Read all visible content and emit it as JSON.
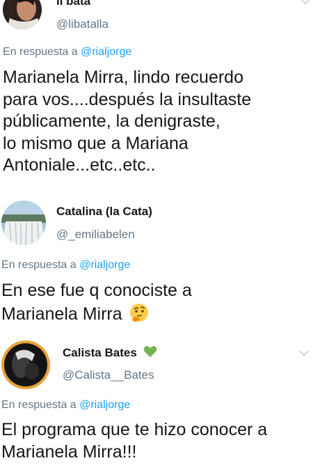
{
  "tweets": [
    {
      "name": "li bata",
      "handle": "@libatalla",
      "reply_prefix": "En respuesta a",
      "reply_to": "@rialjorge",
      "lines": [
        "Marianela Mirra, lindo recuerdo",
        "para vos....después la insultaste",
        "públicamente, la denigraste,",
        "lo mismo que a Mariana",
        "Antoniale...etc..etc.."
      ],
      "avatar_icon": "user-photo-avatar",
      "menu_icon": "chevron-down-icon"
    },
    {
      "name": "Catalina (la Cata)",
      "handle": "@_emiliabelen",
      "reply_prefix": "En respuesta a",
      "reply_to": "@rialjorge",
      "lines": [
        "En ese fue q conociste a",
        "Marianela Mirra"
      ],
      "emoji": "thinking-face-emoji",
      "avatar_icon": "waterfall-photo-avatar"
    },
    {
      "name": "Calista Bates",
      "handle": "@Calista__Bates",
      "reply_prefix": "En respuesta a",
      "reply_to": "@rialjorge",
      "lines": [
        "El programa que te hizo conocer a",
        "Marianela Mirra!!!"
      ],
      "name_emoji": "green-heart-emoji",
      "avatar_icon": "user-photo-avatar",
      "menu_icon": "chevron-down-icon"
    }
  ],
  "colors": {
    "text": "#14171a",
    "secondary": "#657786",
    "link": "#1da1f2",
    "heart": "#77b255"
  }
}
